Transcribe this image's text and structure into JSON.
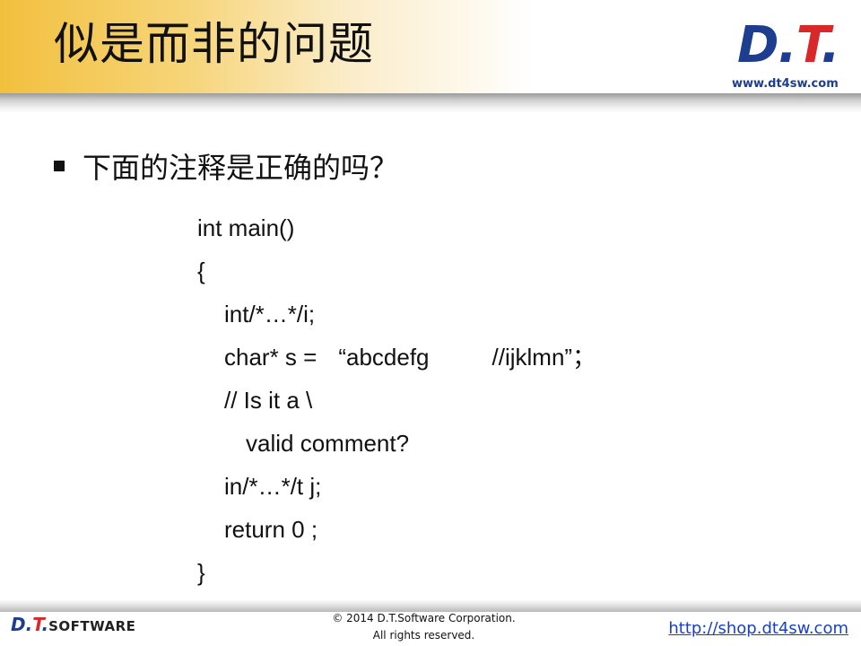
{
  "header": {
    "title": "似是而非的问题",
    "logo": {
      "d": "D",
      "dot1": ".",
      "t": "T",
      "dot2": ".",
      "url": "www.dt4sw.com"
    }
  },
  "content": {
    "bullet": "下面的注释是正确的吗？",
    "code": {
      "line1": "int main()",
      "line2": "{",
      "line3": "int/*…*/i;",
      "line4_part1": "char* s =",
      "line4_part2": "“abcdefg",
      "line4_part3": "//ijklmn”；",
      "line5": "// Is it a \\",
      "line6": "valid comment?",
      "line7": "in/*…*/t j;",
      "line8": "return 0 ;",
      "line9": "}"
    }
  },
  "footer": {
    "logo_dt": "D.",
    "logo_t": "T",
    "logo_dot": ".",
    "logo_software": "SOFTWARE",
    "copyright_line1": "© 2014 D.T.Software Corporation.",
    "copyright_line2": "All rights reserved.",
    "link": "http://shop.dt4sw.com"
  }
}
